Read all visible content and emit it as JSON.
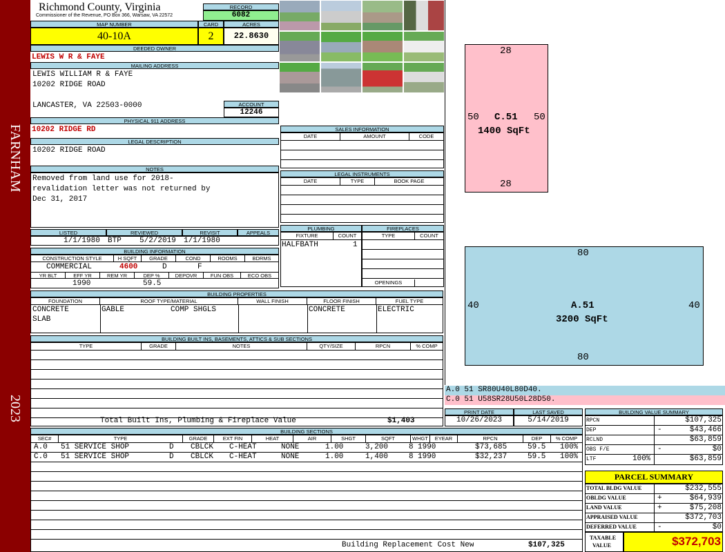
{
  "sidebar": {
    "district": "FARNHAM",
    "year": "2023",
    "color": "#8b0000"
  },
  "header": {
    "county": "Richmond County, Virginia",
    "commissioner": "Commissioner of the Revenue, PO Box 366, Warsaw, VA 22572",
    "record_label": "RECORD",
    "record": "6082",
    "map_label": "MAP NUMBER",
    "map_number": "40-10A",
    "card_label": "CARD",
    "card": "2",
    "acres_label": "ACRES",
    "acres": "22.8630"
  },
  "owner": {
    "deeded_label": "DEEDED OWNER",
    "deeded": "LEWIS W R & FAYE",
    "mailing_label": "MAILING ADDRESS",
    "mail1": "LEWIS WILLIAM R & FAYE",
    "mail2": "10202 RIDGE ROAD",
    "mail3": "LANCASTER, VA 22503-0000",
    "account_label": "ACCOUNT",
    "account": "12246",
    "physical_label": "PHYSICAL 911 ADDRESS",
    "physical": "10202 RIDGE RD",
    "legal_label": "LEGAL DESCRIPTION",
    "legal": "10202 RIDGE ROAD",
    "notes_label": "NOTES",
    "notes1": "Removed from land use for 2018-",
    "notes2": "revalidation letter was not returned by",
    "notes3": "Dec 31, 2017"
  },
  "review": {
    "listed_label": "LISTED",
    "listed": "1/1/1980",
    "reviewed_label": "REVIEWED",
    "reviewer": "BTP",
    "reviewed": "5/2/2019",
    "revisit_label": "REVISIT",
    "revisit": "1/1/1980",
    "appeals_label": "APPEALS",
    "appeals": ""
  },
  "building_info": {
    "label": "BUILDING INFORMATION",
    "headers": [
      "CONSTRUCTION STYLE",
      "H SQFT",
      "GRADE",
      "COND",
      "ROOMS",
      "BDRMS"
    ],
    "values": [
      "COMMERCIAL",
      "4600",
      "D",
      "F",
      "",
      ""
    ],
    "headers2": [
      "YR BLT",
      "EFF YR",
      "REM YR",
      "DEP %",
      "DEPOVR",
      "FUN OBS",
      "ECO OBS"
    ],
    "values2": [
      "",
      "1990",
      "",
      "59.5",
      "",
      "",
      ""
    ]
  },
  "sales": {
    "label": "SALES INFORMATION",
    "cols": [
      "DATE",
      "AMOUNT",
      "CODE"
    ]
  },
  "legal_instr": {
    "label": "LEGAL INSTRUMENTS",
    "cols": [
      "DATE",
      "TYPE",
      "BOOK PAGE"
    ]
  },
  "plumbing": {
    "label": "PLUMBING",
    "cols": [
      "FIXTURE",
      "COUNT"
    ],
    "fixture": "HALFBATH",
    "count": "1"
  },
  "fireplaces": {
    "label": "FIREPLACES",
    "cols": [
      "TYPE",
      "COUNT"
    ],
    "openings": "OPENINGS"
  },
  "props": {
    "label": "BUILDING PROPERTIES",
    "cols": [
      "FOUNDATION",
      "ROOF TYPE/MATERIAL",
      "WALL FINISH",
      "FLOOR FINISH",
      "FUEL TYPE"
    ],
    "foundation1": "CONCRETE",
    "foundation2": "SLAB",
    "roof_type": "GABLE",
    "roof_mat": "COMP SHGLS",
    "wall": "",
    "floor": "CONCRETE",
    "fuel": "ELECTRIC"
  },
  "builtins": {
    "label": "BUILDING BUILT INS, BASEMENTS, ATTICS & SUB SECTIONS",
    "cols": [
      "TYPE",
      "GRADE",
      "NOTES",
      "QTY/SIZE",
      "RPCN",
      "% COMP"
    ],
    "total_label": "Total Built Ins, Plumbing & Fireplace Value",
    "total": "$1,403"
  },
  "dates": {
    "print_label": "PRINT DATE",
    "print": "10/26/2023",
    "saved_label": "LAST SAVED",
    "saved": "5/14/2019"
  },
  "sections": {
    "label": "BUILDING SECTIONS",
    "cols": [
      "SEC#",
      "TYPE",
      "GRADE",
      "EXT FIN",
      "HEAT",
      "AIR",
      "SHGT",
      "SQFT",
      "WHGT",
      "EYEAR",
      "RPCN",
      "DEP",
      "% COMP"
    ],
    "rows": [
      [
        "A.0",
        "51 SERVICE SHOP",
        "D",
        "CBLCK",
        "C-HEAT",
        "NONE",
        "1.00",
        "3,200",
        "8",
        "1990",
        "$73,685",
        "59.5",
        "100%"
      ],
      [
        "C.0",
        "51 SERVICE SHOP",
        "D",
        "CBLCK",
        "C-HEAT",
        "NONE",
        "1.00",
        "1,400",
        "8",
        "1990",
        "$32,237",
        "59.5",
        "100%"
      ]
    ],
    "replacement_label": "Building Replacement Cost New",
    "replacement": "$107,325"
  },
  "sketch": {
    "c": {
      "top": "28",
      "bottom": "28",
      "left": "50",
      "right": "50",
      "label": "C.51",
      "area": "1400 SqFt",
      "color": "#ffc0cb"
    },
    "a": {
      "top": "80",
      "bottom": "80",
      "left": "40",
      "right": "40",
      "label": "A.51",
      "area": "3200 SqFt",
      "color": "#add8e6"
    },
    "code_a": "A.0   51    SR80U40L80D40.",
    "code_c": "C.0   51    U58SR28U50L28D50."
  },
  "bvs": {
    "label": "BUILDING VALUE SUMMARY",
    "rpcn_label": "RPCN",
    "rpcn": "$107,325",
    "dep_label": "DEP",
    "dep_sign": "-",
    "dep": "$43,466",
    "rclnd_label": "RCLND",
    "rclnd": "$63,859",
    "obs_label": "OBS F/E",
    "obs_sign": "-",
    "obs": "$0",
    "ltf_label": "LTF",
    "ltf_pct": "100%",
    "ltf": "$63,859"
  },
  "parcel": {
    "label": "PARCEL SUMMARY",
    "total_label": "TOTAL BLDG VALUE",
    "total": "$232,555",
    "obldg_label": "OBLDG VALUE",
    "obldg_sign": "+",
    "obldg": "$64,939",
    "land_label": "LAND VALUE",
    "land_sign": "+",
    "land": "$75,208",
    "appraised_label": "APPRAISED VALUE",
    "appraised": "$372,703",
    "deferred_label": "DEFERRED VALUE",
    "deferred_sign": "-",
    "deferred": "$0",
    "taxable_label1": "TAXABLE",
    "taxable_label2": "VALUE",
    "taxable": "$372,703"
  },
  "colors": {
    "header_blue": "#add8e6",
    "yellow": "#ffff00",
    "green": "#90ee90",
    "red_text": "#c00000"
  }
}
